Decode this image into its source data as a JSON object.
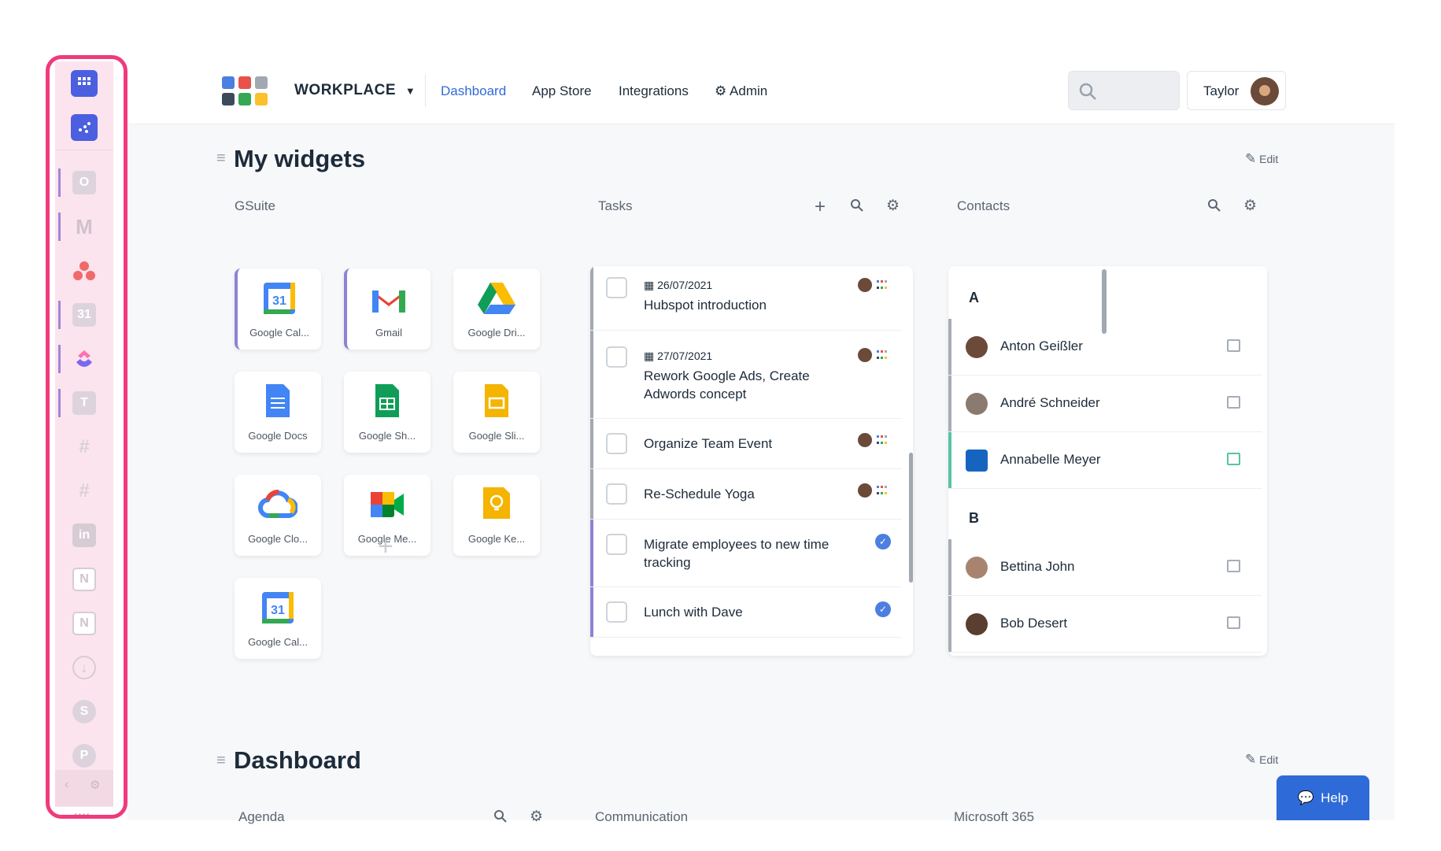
{
  "header": {
    "brand": "WORKPLACE",
    "brand_caret": "▼",
    "nav": [
      {
        "label": "Dashboard",
        "active": true
      },
      {
        "label": "App Store",
        "active": false
      },
      {
        "label": "Integrations",
        "active": false
      },
      {
        "label": "Admin",
        "active": false
      }
    ],
    "admin_icon": "gear-icon",
    "search_icon": "search-icon",
    "user_name": "Taylor"
  },
  "sidebar": {
    "items": [
      "apps-grid-icon",
      "workflow-icon",
      "outlook-icon",
      "gmail-icon",
      "asana-icon",
      "calendar-icon",
      "clickup-icon",
      "teams-icon",
      "slack-icon",
      "slack-icon",
      "linkedin-icon",
      "notion-icon",
      "notion-icon",
      "download-icon",
      "sharepoint-icon",
      "powerpoint-icon"
    ],
    "collapse_icon": "chevron-left-icon",
    "settings_icon": "gear-icon",
    "more_icon": "more-dots-icon"
  },
  "my_widgets": {
    "title": "My widgets",
    "edit_label": "Edit",
    "gsuite": {
      "label": "GSuite",
      "apps": [
        {
          "label": "Google Cal...",
          "icon": "google-calendar-icon"
        },
        {
          "label": "Gmail",
          "icon": "gmail-icon"
        },
        {
          "label": "Google Dri...",
          "icon": "google-drive-icon"
        },
        {
          "label": "Google Docs",
          "icon": "google-docs-icon"
        },
        {
          "label": "Google Sh...",
          "icon": "google-sheets-icon"
        },
        {
          "label": "Google Sli...",
          "icon": "google-slides-icon"
        },
        {
          "label": "Google Clo...",
          "icon": "google-cloud-icon"
        },
        {
          "label": "Google Me...",
          "icon": "google-meet-icon"
        },
        {
          "label": "Google Ke...",
          "icon": "google-keep-icon"
        },
        {
          "label": "Google Cal...",
          "icon": "google-calendar-icon"
        }
      ],
      "add_icon": "plus-icon"
    },
    "tasks": {
      "label": "Tasks",
      "items": [
        {
          "date": "26/07/2021",
          "title": "Hubspot introduction"
        },
        {
          "date": "27/07/2021",
          "title": "Rework Google Ads, Create Adwords concept"
        },
        {
          "date": "",
          "title": "Organize Team Event"
        },
        {
          "date": "",
          "title": "Re-Schedule Yoga"
        },
        {
          "date": "",
          "title": "Migrate employees to new time tracking"
        },
        {
          "date": "",
          "title": "Lunch with Dave"
        }
      ]
    },
    "contacts": {
      "label": "Contacts",
      "groups": [
        {
          "letter": "A",
          "people": [
            "Anton Geißler",
            "André Schneider",
            "Annabelle Meyer"
          ]
        },
        {
          "letter": "B",
          "people": [
            "Bettina John",
            "Bob Desert"
          ]
        }
      ]
    }
  },
  "dashboard": {
    "title": "Dashboard",
    "edit_label": "Edit",
    "columns": [
      "Agenda",
      "Communication",
      "Microsoft 365"
    ]
  },
  "help": {
    "label": "Help"
  },
  "colors": {
    "accent": "#2f6bd8",
    "sidebar_highlight": "#ef3a7d",
    "contact_active": "#57c4a2"
  }
}
